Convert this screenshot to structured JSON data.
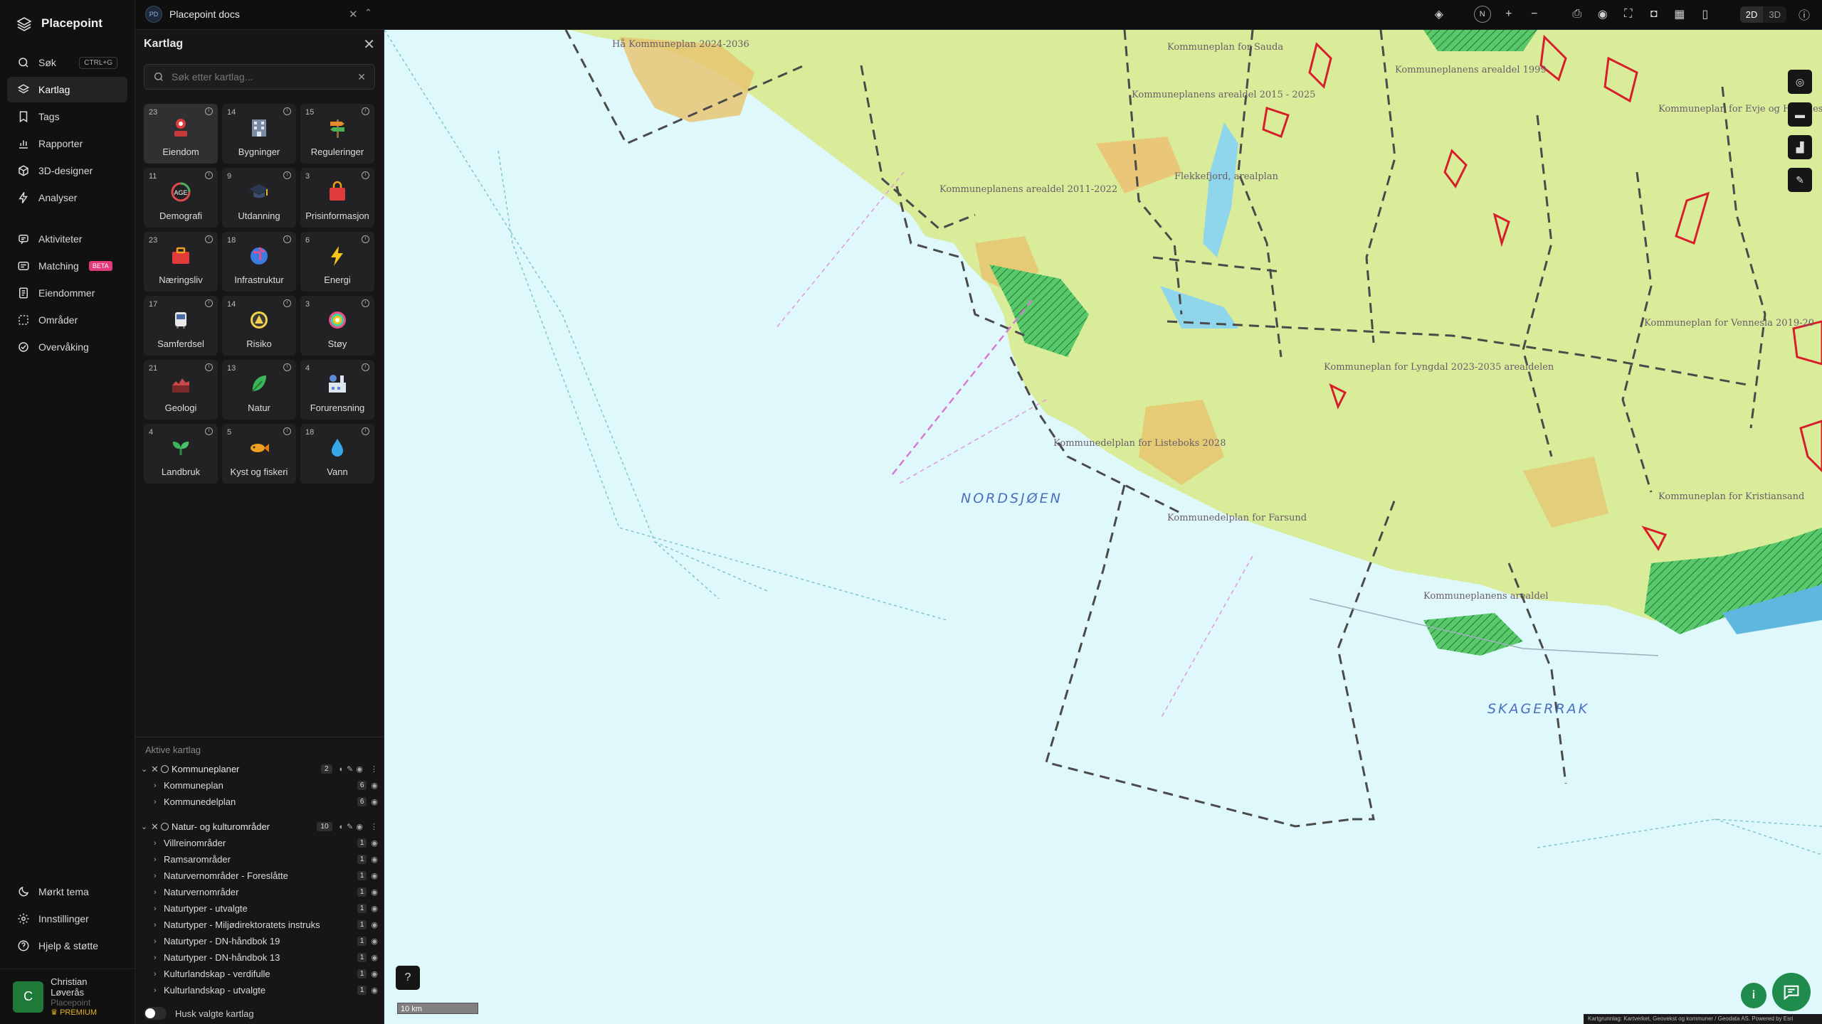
{
  "app": {
    "name": "Placepoint"
  },
  "nav": {
    "search_label": "Søk",
    "search_shortcut": "CTRL+G",
    "kartlag": "Kartlag",
    "tags": "Tags",
    "rapporter": "Rapporter",
    "designer": "3D-designer",
    "analyser": "Analyser",
    "aktiviteter": "Aktiviteter",
    "matching": "Matching",
    "matching_badge": "BETA",
    "eiendommer": "Eiendommer",
    "omrader": "Områder",
    "overvaking": "Overvåking",
    "dark_theme": "Mørkt tema",
    "settings": "Innstillinger",
    "help": "Hjelp & støtte"
  },
  "user": {
    "initial": "C",
    "name": "Christian Løverås",
    "org": "Placepoint",
    "plan": "PREMIUM"
  },
  "workspace": {
    "badge": "PD",
    "name": "Placepoint docs"
  },
  "topbar": {
    "compass": "N",
    "mode_2d": "2D",
    "mode_3d": "3D"
  },
  "panel": {
    "title": "Kartlag",
    "search_placeholder": "Søk etter kartlag...",
    "categories": [
      {
        "count": "23",
        "label": "Eiendom",
        "icon": "property-pin-icon",
        "active": true
      },
      {
        "count": "14",
        "label": "Bygninger",
        "icon": "building-icon"
      },
      {
        "count": "15",
        "label": "Reguleringer",
        "icon": "signpost-icon"
      },
      {
        "count": "11",
        "label": "Demografi",
        "icon": "age-chart-icon"
      },
      {
        "count": "9",
        "label": "Utdanning",
        "icon": "graduation-cap-icon"
      },
      {
        "count": "3",
        "label": "Prisinformasjon",
        "icon": "shopping-bag-icon"
      },
      {
        "count": "23",
        "label": "Næringsliv",
        "icon": "business-bag-icon"
      },
      {
        "count": "18",
        "label": "Infrastruktur",
        "icon": "globe-icon"
      },
      {
        "count": "6",
        "label": "Energi",
        "icon": "lightning-icon"
      },
      {
        "count": "17",
        "label": "Samferdsel",
        "icon": "bus-icon"
      },
      {
        "count": "14",
        "label": "Risiko",
        "icon": "hazard-icon"
      },
      {
        "count": "3",
        "label": "Støy",
        "icon": "noise-icon"
      },
      {
        "count": "21",
        "label": "Geologi",
        "icon": "terrain-icon"
      },
      {
        "count": "13",
        "label": "Natur",
        "icon": "leaf-icon"
      },
      {
        "count": "4",
        "label": "Forurensning",
        "icon": "factory-icon"
      },
      {
        "count": "4",
        "label": "Landbruk",
        "icon": "sprout-icon"
      },
      {
        "count": "5",
        "label": "Kyst og fiskeri",
        "icon": "fish-icon"
      },
      {
        "count": "18",
        "label": "Vann",
        "icon": "water-drop-icon"
      }
    ],
    "active_title": "Aktive kartlag",
    "groups": [
      {
        "name": "Kommuneplaner",
        "count": "2",
        "items": [
          {
            "name": "Kommuneplan",
            "count": "6"
          },
          {
            "name": "Kommunedelplan",
            "count": "6"
          }
        ]
      },
      {
        "name": "Natur- og kulturområder",
        "count": "10",
        "items": [
          {
            "name": "Villreinområder",
            "count": "1"
          },
          {
            "name": "Ramsarområder",
            "count": "1"
          },
          {
            "name": "Naturvernområder - Foreslåtte",
            "count": "1"
          },
          {
            "name": "Naturvernområder",
            "count": "1"
          },
          {
            "name": "Naturtyper - utvalgte",
            "count": "1"
          },
          {
            "name": "Naturtyper - Miljødirektoratets instruks",
            "count": "1"
          },
          {
            "name": "Naturtyper - DN-håndbok 19",
            "count": "1"
          },
          {
            "name": "Naturtyper - DN-håndbok 13",
            "count": "1"
          },
          {
            "name": "Kulturlandskap - verdifulle",
            "count": "1"
          },
          {
            "name": "Kulturlandskap - utvalgte",
            "count": "1"
          }
        ]
      }
    ],
    "remember": "Husk valgte kartlag"
  },
  "map": {
    "sea1": "NORDSJØEN",
    "sea2": "SKAGERRAK",
    "scale": "10 km",
    "labels": [
      "Hå Kommuneplan 2024-2036",
      "Kommuneplan for Sauda",
      "Kommuneplanens arealdel 2015 - 2025",
      "Kommuneplanens arealdel 1999",
      "Flekkefjord, arealplan",
      "Kommuneplanens arealdel 2011-2022",
      "Kommuneplan for Lyngdal 2023-2035 arealdelen",
      "Kommuneplan for Vennesla 2019-20",
      "Kommuneplan for Kristiansand",
      "Kommunedelplan for Listeboks 2028",
      "Kommunedelplan for Farsund",
      "Kommuneplan for Evje og Hornnes",
      "Kommuneplanens arealdel"
    ],
    "attribution": "Kartgrunnlag: Kartverket, Geovekst og kommuner / Geodata AS. Powered by Esri",
    "colors": {
      "sea": "#dff8fb",
      "land": "#d9ec9a",
      "accent_green": "#1f8b4c"
    }
  }
}
